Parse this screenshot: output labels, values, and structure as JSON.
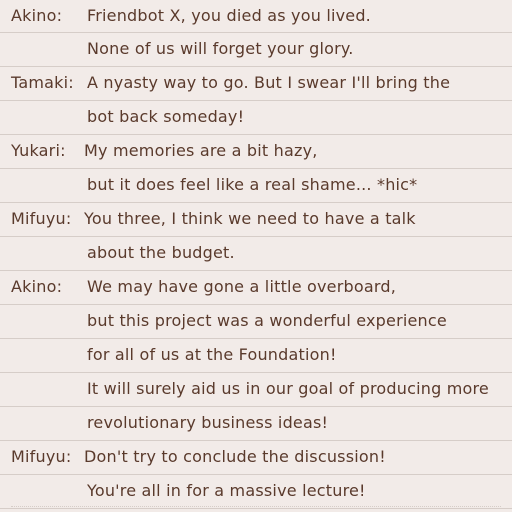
{
  "log": [
    {
      "speaker": "Akino:",
      "text": "Friendbot X, you died as you lived."
    },
    {
      "speaker": "",
      "text": "None of us will forget your glory."
    },
    {
      "speaker": "Tamaki:",
      "text": "A nyasty way to go. But I swear I'll bring the"
    },
    {
      "speaker": "",
      "text": "bot back someday!"
    },
    {
      "speaker": "Yukari:",
      "text": "My memories are a bit hazy,"
    },
    {
      "speaker": "",
      "text": "but it does feel like a real shame... *hic*"
    },
    {
      "speaker": "Mifuyu:",
      "text": "You three, I think we need to have a talk"
    },
    {
      "speaker": "",
      "text": "about the budget."
    },
    {
      "speaker": "Akino:",
      "text": "We may have gone a little overboard,"
    },
    {
      "speaker": "",
      "text": "but this project was a wonderful experience"
    },
    {
      "speaker": "",
      "text": "for all of us at the Foundation!"
    },
    {
      "speaker": "",
      "text": "It will surely aid us in our goal of producing more"
    },
    {
      "speaker": "",
      "text": "revolutionary business ideas!"
    },
    {
      "speaker": "Mifuyu:",
      "text": "Don't try to conclude the discussion!"
    },
    {
      "speaker": "",
      "text": "You're all in for a massive lecture!"
    }
  ],
  "colors": {
    "background": "#f2ebe8",
    "text": "#5a3a2c",
    "rule": "#d6cdc8"
  }
}
